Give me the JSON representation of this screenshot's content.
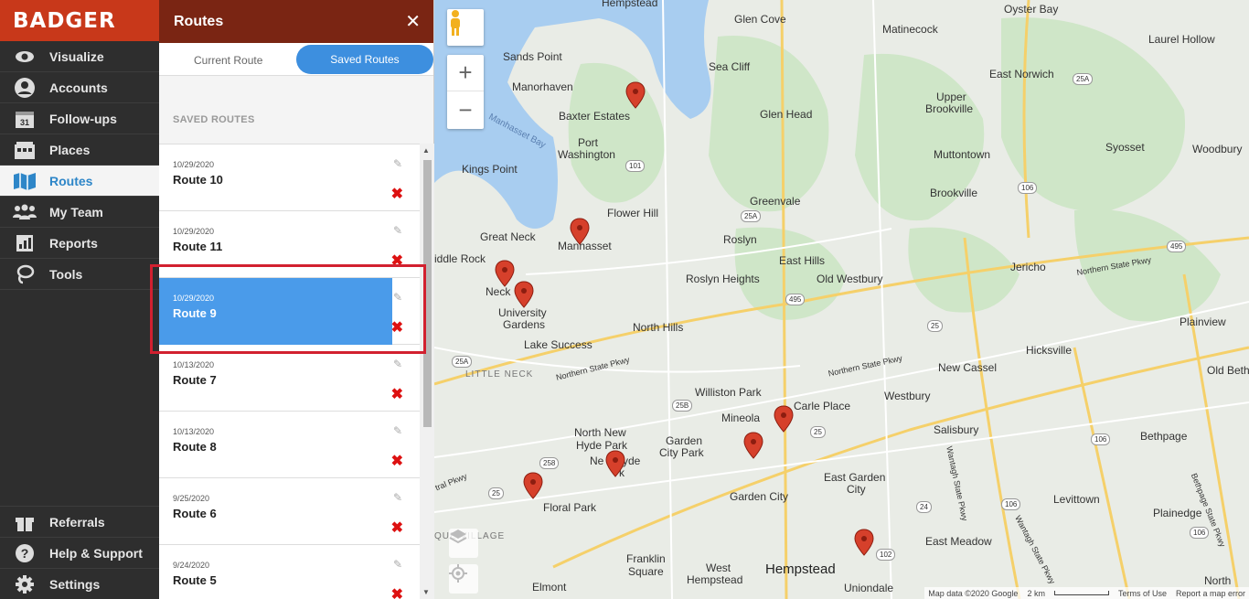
{
  "app": {
    "logo_text": "BADGER",
    "accent": "#c8381a"
  },
  "nav": {
    "items": [
      {
        "label": "Visualize",
        "icon": "eye-icon"
      },
      {
        "label": "Accounts",
        "icon": "user-icon"
      },
      {
        "label": "Follow-ups",
        "icon": "calendar-icon",
        "icon_text": "31"
      },
      {
        "label": "Places",
        "icon": "building-icon"
      },
      {
        "label": "Routes",
        "icon": "map-icon",
        "active": true
      },
      {
        "label": "My Team",
        "icon": "team-icon"
      },
      {
        "label": "Reports",
        "icon": "report-icon"
      },
      {
        "label": "Tools",
        "icon": "lasso-icon"
      }
    ],
    "bottom": [
      {
        "label": "Referrals",
        "icon": "gift-icon"
      },
      {
        "label": "Help & Support",
        "icon": "help-icon"
      },
      {
        "label": "Settings",
        "icon": "gear-icon"
      }
    ]
  },
  "panel": {
    "title": "Routes",
    "close": "✕",
    "tabs": {
      "current": "Current Route",
      "saved": "Saved Routes"
    },
    "section_label": "SAVED ROUTES",
    "routes": [
      {
        "date": "10/29/2020",
        "name": "Route 10"
      },
      {
        "date": "10/29/2020",
        "name": "Route 11"
      },
      {
        "date": "10/29/2020",
        "name": "Route 9",
        "selected": true
      },
      {
        "date": "10/13/2020",
        "name": "Route 7"
      },
      {
        "date": "10/13/2020",
        "name": "Route 8"
      },
      {
        "date": "9/25/2020",
        "name": "Route 6"
      },
      {
        "date": "9/24/2020",
        "name": "Route 5"
      }
    ]
  },
  "map": {
    "labels": {
      "hempstead_top": "Hempstead",
      "oyster_bay": "Oyster Bay",
      "glen_cove": "Glen Cove",
      "matinecock": "Matinecock",
      "laurel_hollow": "Laurel Hollow",
      "sands_point": "Sands Point",
      "sea_cliff": "Sea Cliff",
      "east_norwich": "East Norwich",
      "manorhaven": "Manorhaven",
      "baxter_estates": "Baxter Estates",
      "upper_brookville": "Upper",
      "upper_brookville2": "Brookville",
      "glen_head": "Glen Head",
      "syosset": "Syosset",
      "woodbury": "Woodbury",
      "manhasset_bay": "Manhasset Bay",
      "port_washington": "Port",
      "port_washington2": "Washington",
      "muttontown": "Muttontown",
      "kings_point": "Kings Point",
      "brookville": "Brookville",
      "greenvale": "Greenvale",
      "flower_hill": "Flower Hill",
      "great_neck": "Great Neck",
      "manhasset": "Manhasset",
      "roslyn": "Roslyn",
      "east_hills": "East Hills",
      "jericho": "Jericho",
      "middle_rock": "iddle Rock",
      "neck": "Neck",
      "roslyn_heights": "Roslyn Heights",
      "old_westbury": "Old Westbury",
      "northern_state_1": "Northern State Pkwy",
      "university_gardens": "University",
      "university_gardens2": "Gardens",
      "north_hills": "North Hills",
      "plainview": "Plainview",
      "lake_success": "Lake Success",
      "hicksville": "Hicksville",
      "little_neck": "LITTLE NECK",
      "northern_state_2": "Northern State Pkwy",
      "northern_state_3": "Northern State Pkwy",
      "new_cassel": "New Cassel",
      "old_beth": "Old Beth",
      "williston_park": "Williston Park",
      "carle_place": "Carle Place",
      "westbury": "Westbury",
      "mineola": "Mineola",
      "north_new_hyde_park": "North New",
      "north_new_hyde_park2": "Hyde Park",
      "salisbury": "Salisbury",
      "garden_city_park": "Garden",
      "garden_city_park2": "City Park",
      "bethpage": "Bethpage",
      "new_hyde_park": "Ne",
      "new_hyde_park2": "yde",
      "new_hyde_park3": "k",
      "wantagh_1": "Wantagh State Pkwy",
      "east_garden_city": "East Garden",
      "east_garden_city2": "City",
      "floral_park": "Floral Park",
      "garden_city": "Garden City",
      "levittown": "Levittown",
      "plainedge": "Plainedge",
      "queens_village": "QUE  VILLAGE",
      "east_meadow": "East Meadow",
      "wantagh_2": "Wantagh State Pkwy",
      "bethpage_pkwy": "Bethpage State Pkwy",
      "franklin_square": "Franklin",
      "franklin_square2": "Square",
      "west_hempstead": "West",
      "west_hempstead2": "Hempstead",
      "hempstead": "Hempstead",
      "elmont": "Elmont",
      "uniondale": "Uniondale",
      "north": "North",
      "cross_pkwy": "tral Pkwy"
    },
    "shields": [
      "25A",
      "101",
      "106",
      "25A",
      "495",
      "495",
      "25",
      "25A",
      "25B",
      "25",
      "106",
      "258",
      "25",
      "24",
      "106",
      "106",
      "102"
    ],
    "attribution": {
      "data": "Map data ©2020 Google",
      "scale": "2 km",
      "terms": "Terms of Use",
      "report": "Report a map error"
    }
  }
}
